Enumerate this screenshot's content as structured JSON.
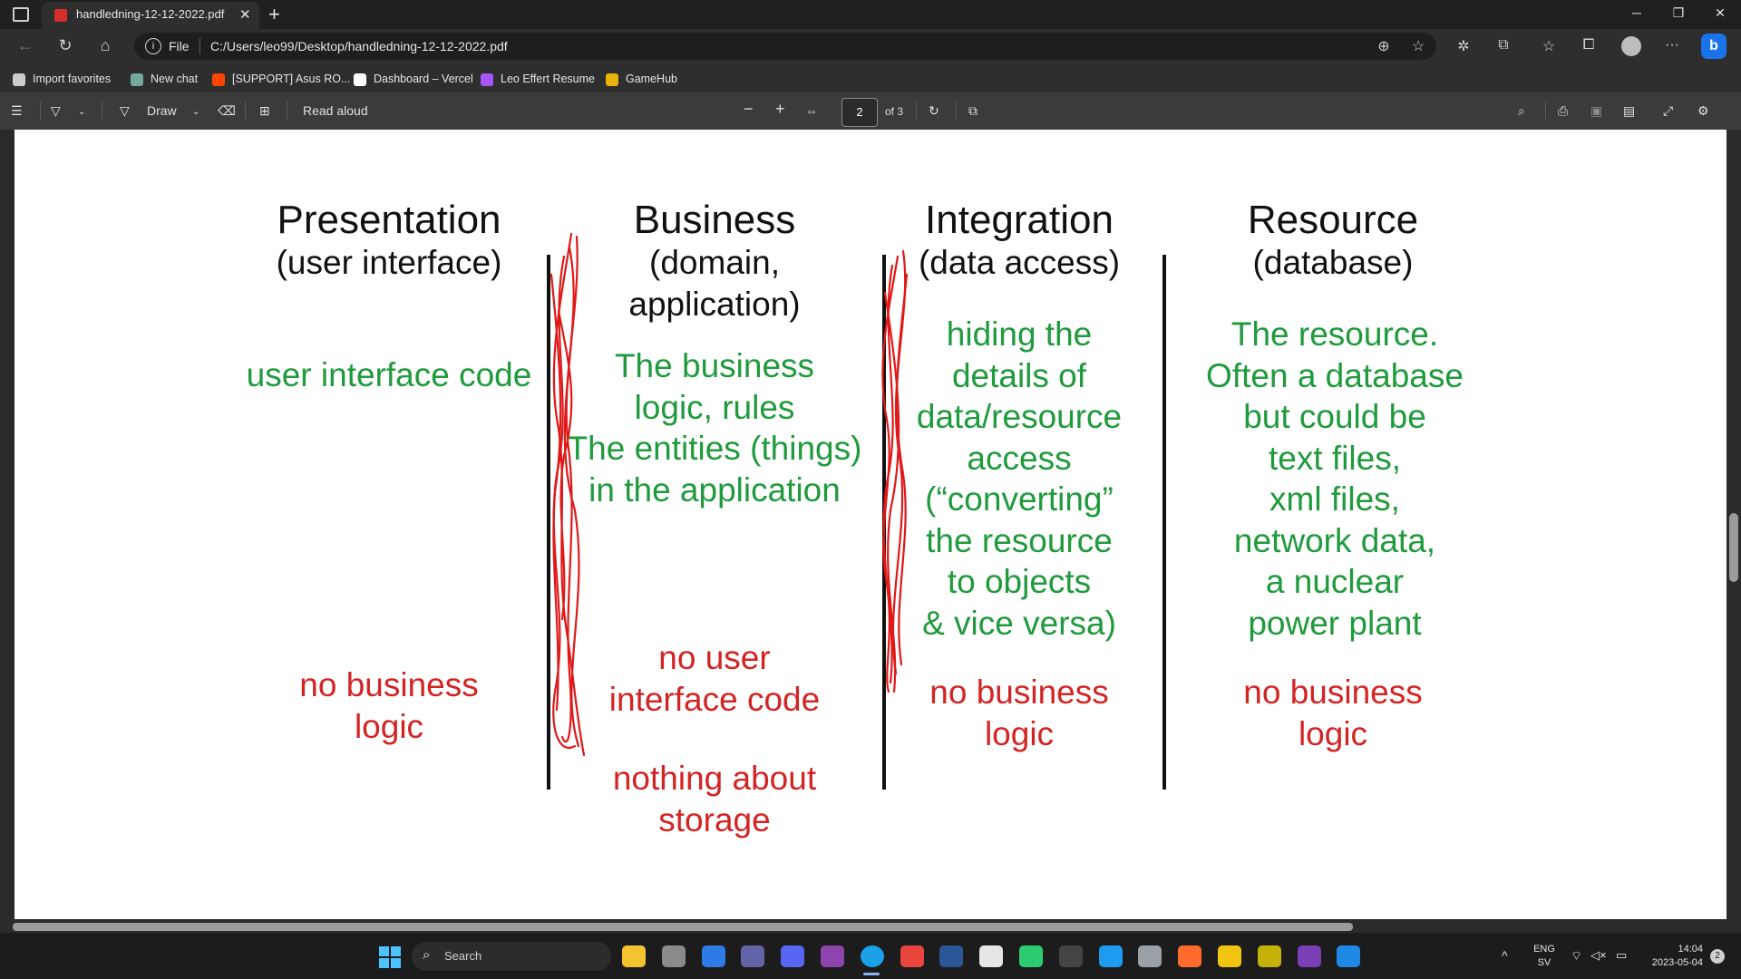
{
  "browser": {
    "tab_title": "handledning-12-12-2022.pdf",
    "new_tab_symbol": "+",
    "address_prefix": "File",
    "address": "C:/Users/leo99/Desktop/handledning-12-12-2022.pdf",
    "more_symbol": "···"
  },
  "favorites": [
    {
      "label": "Import favorites",
      "color": "#cccccc"
    },
    {
      "label": "New chat",
      "color": "#74aa9c"
    },
    {
      "label": "[SUPPORT] Asus RO...",
      "color": "#ff4500"
    },
    {
      "label": "Dashboard – Vercel",
      "color": "#ffffff"
    },
    {
      "label": "Leo Effert Resume",
      "color": "#a855f7"
    },
    {
      "label": "GameHub",
      "color": "#eab308"
    }
  ],
  "pdf_toolbar": {
    "draw_label": "Draw",
    "read_aloud_label": "Read aloud",
    "zoom_out": "−",
    "zoom_in": "+",
    "page_number": "2",
    "page_total": "of 3"
  },
  "slide": {
    "columns": [
      {
        "heading": "Presentation",
        "sub": [
          "(user interface)"
        ],
        "green": [
          "user interface code"
        ],
        "red": [
          "no business",
          "logic"
        ]
      },
      {
        "heading": "Business",
        "sub": [
          "(domain,",
          "application)"
        ],
        "green": [
          "The business",
          "logic, rules",
          "The entities (things)",
          "in the application"
        ],
        "red": [
          "no user",
          "interface code"
        ],
        "red2": [
          "nothing about",
          "storage"
        ]
      },
      {
        "heading": "Integration",
        "sub": [
          "(data access)"
        ],
        "green": [
          "hiding the",
          "details of",
          "data/resource",
          "access",
          "(“converting”",
          "the resource",
          "to objects",
          "& vice versa)"
        ],
        "red": [
          "no business",
          "logic"
        ]
      },
      {
        "heading": "Resource",
        "sub": [
          "(database)"
        ],
        "green": [
          "The resource.",
          "Often a database",
          "but could be",
          "text files,",
          "xml files,",
          "network data,",
          "a nuclear",
          "power plant"
        ],
        "red": [
          "no business",
          "logic"
        ]
      }
    ]
  },
  "taskbar": {
    "search_label": "Search",
    "lang": "ENG",
    "lang_sub": "SV",
    "time": "14:04",
    "date": "2023-05-04",
    "notification_count": "2"
  }
}
